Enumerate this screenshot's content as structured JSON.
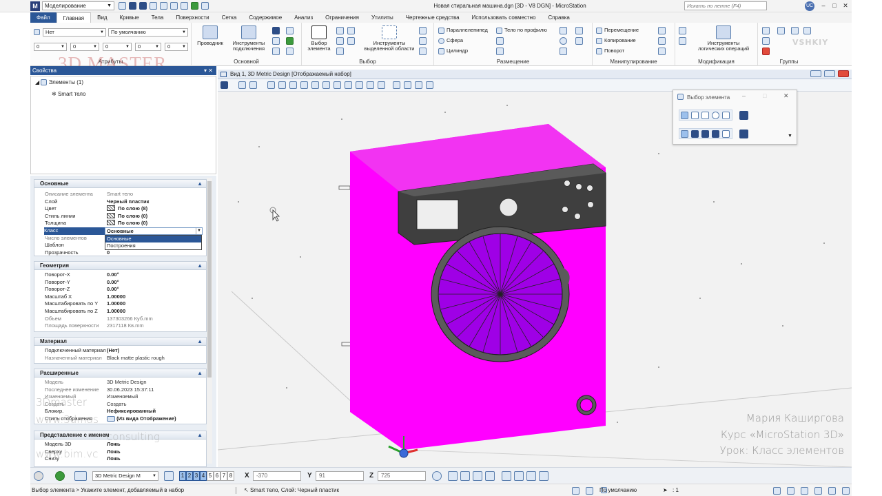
{
  "app": {
    "workflow": "Моделирование",
    "title": "Новая стиральная машина.dgn [3D - V8 DGN] - MicroStation",
    "search_placeholder": "Искать по ленте (F4)",
    "user_initials": "UC"
  },
  "menu": [
    "Файл",
    "Главная",
    "Вид",
    "Кривые",
    "Тела",
    "Поверхности",
    "Сетка",
    "Содержимое",
    "Анализ",
    "Ограничения",
    "Утилиты",
    "Чертежные средства",
    "Использовать совместно",
    "Справка"
  ],
  "ribbon": {
    "attributes": {
      "label": "Атрибуты",
      "level": "Нет",
      "style": "По умолчанию",
      "color": "0",
      "weight": "0",
      "linestyle": "0",
      "transparency": "0",
      "priority": "0"
    },
    "primary": {
      "label": "Основной",
      "explorer": "Проводник",
      "attach_tools_line1": "Инструменты",
      "attach_tools_line2": "подключения"
    },
    "selection": {
      "label": "Выбор",
      "select_element_line1": "Выбор",
      "select_element_line2": "элемента",
      "area_tools_line1": "Инструменты",
      "area_tools_line2": "выделенной области"
    },
    "placement": {
      "label": "Размещение",
      "slab": "Параллелепипед",
      "sphere": "Сфера",
      "cylinder": "Цилиндр",
      "profile_solid": "Тело по профилю"
    },
    "manipulate": {
      "label": "Манипулирование",
      "move": "Перемещение",
      "copy": "Копирование",
      "rotate": "Поворот"
    },
    "modify": {
      "label": "Модификация",
      "boolean_line1": "Инструменты",
      "boolean_line2": "логических операций"
    },
    "groups": {
      "label": "Группы"
    }
  },
  "properties": {
    "title": "Свойства",
    "tree_root": "Элементы (1)",
    "tree_child": "Smart тело",
    "sections": {
      "basic": {
        "title": "Основные",
        "rows": [
          {
            "k": "Описание элемента",
            "v": "Smart тело"
          },
          {
            "k": "Слой",
            "v": "Черный пластик"
          },
          {
            "k": "Цвет",
            "v": "По слою (8)"
          },
          {
            "k": "Стиль линии",
            "v": "По слою (0)"
          },
          {
            "k": "Толщина",
            "v": "По слою (0)"
          },
          {
            "k": "Класс",
            "v": ""
          },
          {
            "k": "Число элементов",
            "v": ""
          },
          {
            "k": "Шаблон",
            "v": ""
          },
          {
            "k": "Прозрачность",
            "v": "0"
          }
        ]
      },
      "geometry": {
        "title": "Геометрия",
        "rows": [
          {
            "k": "Поворот-X",
            "v": "0.00°"
          },
          {
            "k": "Поворот-Y",
            "v": "0.00°"
          },
          {
            "k": "Поворот-Z",
            "v": "0.00°"
          },
          {
            "k": "Масштаб X",
            "v": "1.00000"
          },
          {
            "k": "Масштабировать по Y",
            "v": "1.00000"
          },
          {
            "k": "Масштабировать по Z",
            "v": "1.00000"
          },
          {
            "k": "Объем",
            "v": "137303266  Куб.mm"
          },
          {
            "k": "Площадь поверхности",
            "v": "2317118  Кв.mm"
          }
        ]
      },
      "material": {
        "title": "Материал",
        "rows": [
          {
            "k": "Подключенный материал",
            "v": "(Нет)"
          },
          {
            "k": "Назначенный материал",
            "v": "Black matte plastic rough"
          }
        ]
      },
      "extended": {
        "title": "Расширенные",
        "rows": [
          {
            "k": "Модель",
            "v": "3D Metric Design"
          },
          {
            "k": "Последнее изменение",
            "v": "30.06.2023 15:37:11"
          },
          {
            "k": "Изменяемый",
            "v": "Изменяемый"
          },
          {
            "k": "Создать",
            "v": "Создать"
          },
          {
            "k": "Блокир.",
            "v": "Нефиксированный"
          },
          {
            "k": "Стиль отображения",
            "v": "(Из вида Отображение)"
          }
        ]
      },
      "named": {
        "title": "Представление с именем",
        "rows": [
          {
            "k": "Модель 3D",
            "v": "Ложь"
          },
          {
            "k": "Сверху",
            "v": "Ложь"
          },
          {
            "k": "Снизу",
            "v": "Ложь"
          }
        ]
      }
    },
    "class_dropdown": {
      "value": "Основные",
      "options": [
        "Основные",
        "Построения"
      ]
    }
  },
  "view": {
    "title": "Вид 1, 3D Metric Design [Отображаемый набор]"
  },
  "element_selection": {
    "title": "Выбор элемента"
  },
  "watermarks": {
    "brand": "3D MASTER",
    "site_line1": "3Dmaster",
    "site_line2": "www.3dmas",
    "site_line3": "consulting",
    "site_line4": "www.bim.vc",
    "author": "Мария Каширгова",
    "course": "Курс «MicroStation 3D»",
    "lesson": "Урок: Класс элементов",
    "corner": "VSHKIY"
  },
  "bottom": {
    "model": "3D Metric Design M",
    "views": [
      "1",
      "2",
      "3",
      "4",
      "5",
      "6",
      "7",
      "8"
    ],
    "x": "-370",
    "y": "91",
    "z": "725"
  },
  "status": {
    "prompt": "Выбор элемента > Укажите элемент, добавляемый в набор",
    "info": "Smart тело, Слой: Черный пластик",
    "default": "По умолчанию",
    "scale": ": 1"
  },
  "colors": {
    "accent": "#2b5797",
    "machine": "#ff00ff",
    "drum": "#b400ff",
    "panel": "#444444"
  }
}
